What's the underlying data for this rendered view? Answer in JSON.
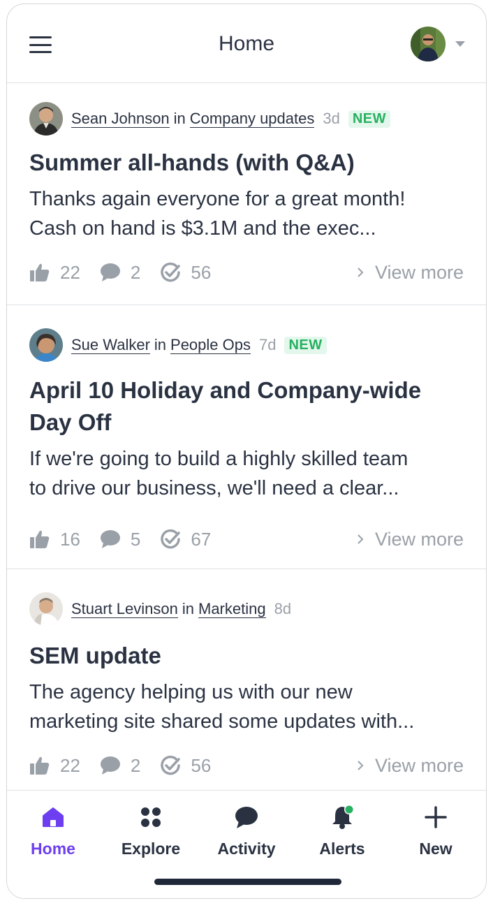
{
  "header": {
    "title": "Home",
    "menu_icon": "menu-icon",
    "avatar": "user-avatar"
  },
  "posts": [
    {
      "author": "Sean Johnson",
      "in": "in",
      "channel": "Company updates",
      "age": "3d",
      "badge": "NEW",
      "title": "Summer all-hands (with Q&A)",
      "body_line1": "Thanks again everyone for a great month!",
      "body_line2": "Cash on hand is $3.1M and the exec...",
      "likes": "22",
      "comments": "2",
      "views": "56",
      "view_more": "View more"
    },
    {
      "author": "Sue Walker",
      "in": "in",
      "channel": "People Ops",
      "age": "7d",
      "badge": "NEW",
      "title_line1": "April 10 Holiday and Company-wide",
      "title_line2": "Day Off",
      "body_line1": "If we're going to build a highly skilled team",
      "body_line2": "to drive our business, we'll need a clear...",
      "likes": "16",
      "comments": "5",
      "views": "67",
      "view_more": "View more"
    },
    {
      "author": "Stuart Levinson",
      "in": "in",
      "channel": "Marketing",
      "age": "8d",
      "title": "SEM update",
      "body_line1": "The agency helping us with our new",
      "body_line2": "marketing site shared some updates with...",
      "likes": "22",
      "comments": "2",
      "views": "56",
      "view_more": "View more"
    }
  ],
  "tabs": [
    {
      "label": "Home",
      "icon": "home-icon",
      "active": true
    },
    {
      "label": "Explore",
      "icon": "explore-icon"
    },
    {
      "label": "Activity",
      "icon": "chat-bubble-icon"
    },
    {
      "label": "Alerts",
      "icon": "bell-icon",
      "has_dot": true
    },
    {
      "label": "New",
      "icon": "plus-icon"
    }
  ],
  "colors": {
    "accent": "#6d3ff0",
    "text": "#2a3242",
    "muted": "#9aa0a8",
    "badge_bg": "#e4f7ec",
    "badge_text": "#26b160",
    "alert_dot": "#26b160",
    "divider": "#dfe1e5"
  }
}
